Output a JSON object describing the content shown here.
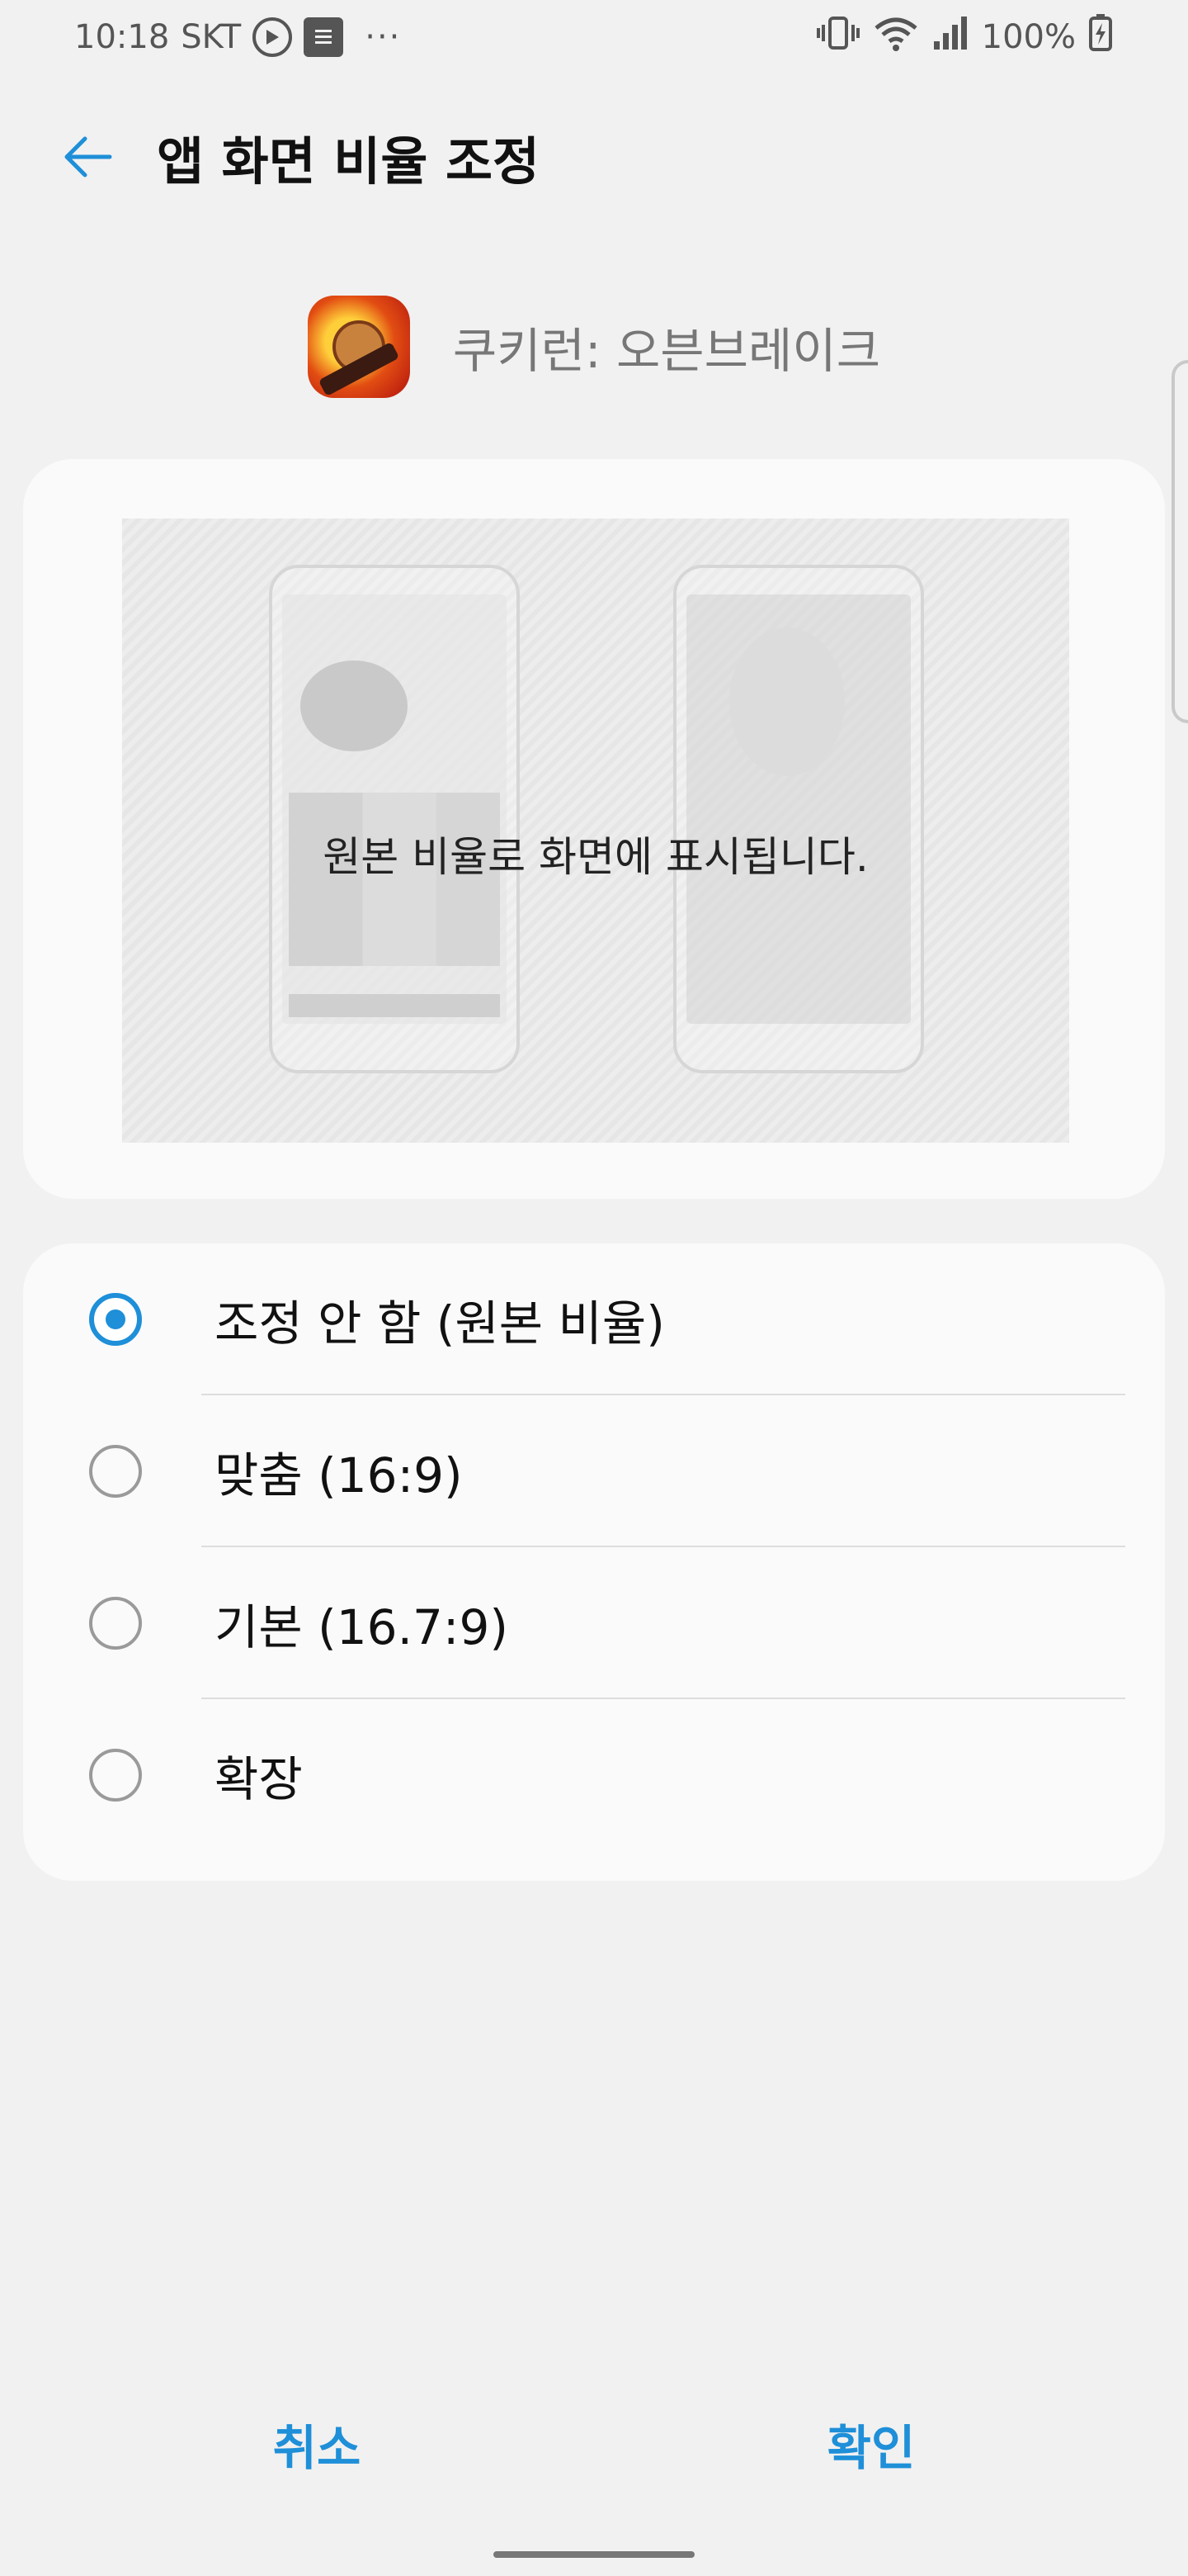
{
  "status_bar": {
    "time": "10:18",
    "carrier": "SKT",
    "more": "···",
    "battery": "100%"
  },
  "header": {
    "title": "앱 화면 비율 조정",
    "back_icon": "arrow-left-icon"
  },
  "app": {
    "name": "쿠키런: 오븐브레이크",
    "icon": "cookie-run-app-icon"
  },
  "preview": {
    "caption": "원본 비율로 화면에 표시됩니다."
  },
  "options": [
    {
      "label": "조정 안 함 (원본 비율)",
      "checked": true
    },
    {
      "label": "맞춤 (16:9)",
      "checked": false
    },
    {
      "label": "기본 (16.7:9)",
      "checked": false
    },
    {
      "label": "확장",
      "checked": false
    }
  ],
  "actions": {
    "cancel": "취소",
    "ok": "확인"
  },
  "colors": {
    "accent": "#1e8fd8",
    "background": "#f1f1f1",
    "card": "#fafafa"
  }
}
